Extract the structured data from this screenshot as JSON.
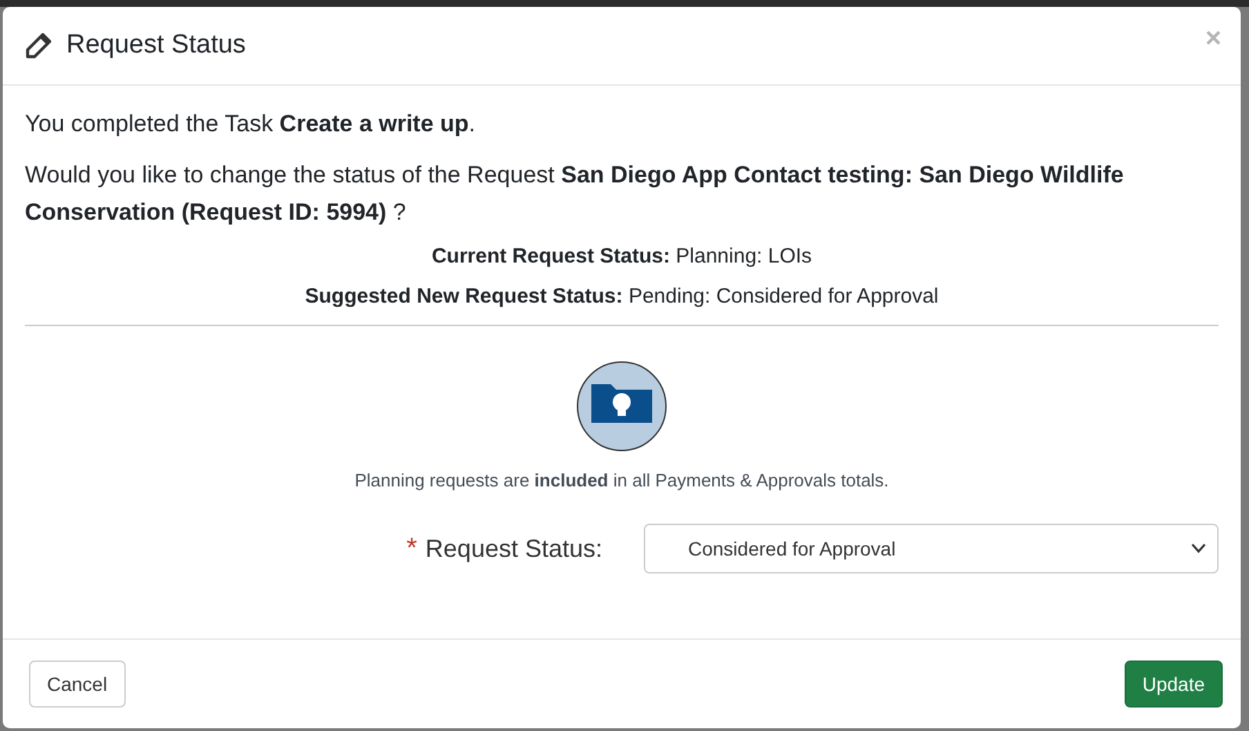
{
  "dialog": {
    "title": "Request Status",
    "close": "×",
    "messages": [
      "You completed the Task **Create a write up**.",
      "Would you like to change the status of the Request **San Diego App Contact testing: San Diego Wildlife Conservation (Request ID: 5994)** ?"
    ],
    "status_lines": [
      {
        "label": "Current Request Status:",
        "value": "Planning: LOIs"
      },
      {
        "label": "Suggested New Request Status:",
        "value": "Pending: Considered for Approval"
      }
    ],
    "note": "Planning requests are **included** in all Payments & Approvals totals.",
    "field": {
      "required_mark": "*",
      "label": "Request Status:",
      "value": "Considered for Approval"
    },
    "buttons": [
      {
        "kind": "secondary",
        "label": "Cancel"
      },
      {
        "kind": "primary",
        "label": "Update"
      }
    ]
  }
}
